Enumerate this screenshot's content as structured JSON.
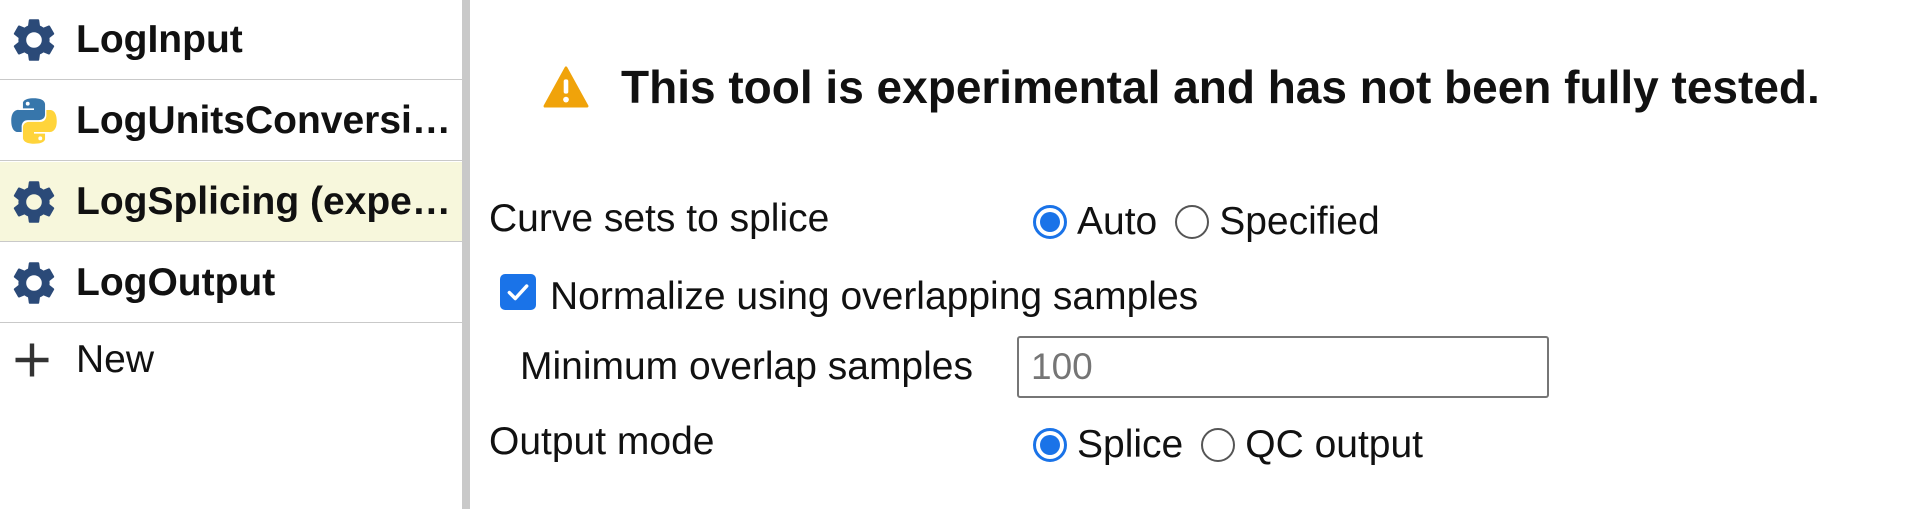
{
  "sidebar": {
    "items": [
      {
        "label": "LogInput",
        "icon": "gear-icon",
        "selected": false
      },
      {
        "label": "LogUnitsConversion",
        "icon": "python-icon",
        "selected": false
      },
      {
        "label": "LogSplicing (experimental)",
        "icon": "gear-icon",
        "selected": true
      },
      {
        "label": "LogOutput",
        "icon": "gear-icon",
        "selected": false
      }
    ],
    "new_label": "New"
  },
  "main": {
    "warning": "This tool is experimental and has not been fully tested.",
    "curve_sets": {
      "label": "Curve sets to splice",
      "options": [
        {
          "label": "Auto",
          "checked": true
        },
        {
          "label": "Specified",
          "checked": false
        }
      ]
    },
    "normalize": {
      "label": "Normalize using overlapping samples",
      "checked": true
    },
    "min_overlap": {
      "label": "Minimum overlap samples",
      "placeholder": "100"
    },
    "output_mode": {
      "label": "Output mode",
      "options": [
        {
          "label": "Splice",
          "checked": true
        },
        {
          "label": "QC output",
          "checked": false
        }
      ]
    }
  },
  "colors": {
    "accent": "#1a73e8",
    "warning": "#f0a30a",
    "selected_bg": "#f7f7dc",
    "gear": "#2b4a78"
  }
}
